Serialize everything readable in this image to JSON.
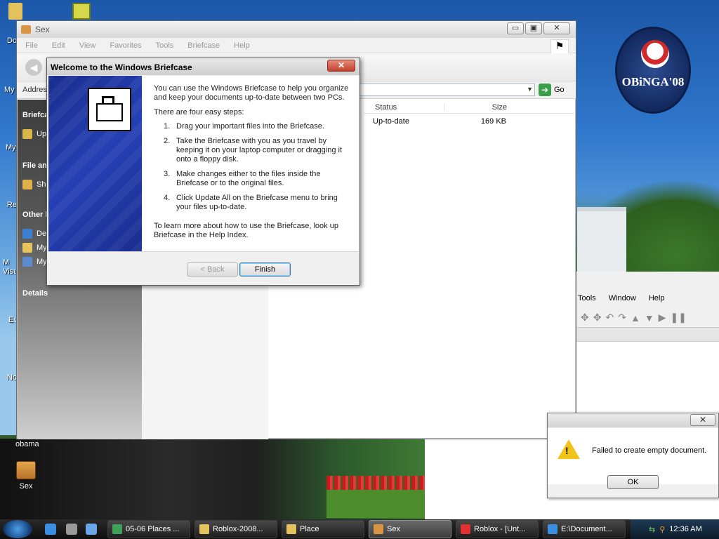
{
  "desktop": {
    "icons": [
      {
        "label": "Sex"
      }
    ],
    "partial_labels": [
      "Do",
      "My",
      "My",
      "Re",
      "M Visu",
      "Ev",
      "No",
      "obama"
    ],
    "logo_text": "OBiNGA'08"
  },
  "explorer": {
    "title": "Sex",
    "menu": [
      "File",
      "Edit",
      "View",
      "Favorites",
      "Tools",
      "Briefcase",
      "Help"
    ],
    "address_label": "Addres",
    "go_label": "Go",
    "taskpane": {
      "sections": [
        "Briefcas",
        "File an",
        "Other l",
        "Details"
      ],
      "items": [
        "Up",
        "Sh",
        "De",
        "My",
        "My"
      ]
    },
    "columns": {
      "status": "Status",
      "size": "Size"
    },
    "rows": [
      {
        "status": "Up-to-date",
        "size": "169 KB"
      }
    ]
  },
  "wizard": {
    "title": "Welcome to the Windows Briefcase",
    "intro": "You can use the Windows Briefcase to help you organize and keep your documents up-to-date between two PCs.",
    "steps_intro": "There are four easy steps:",
    "steps": [
      {
        "n": "1.",
        "text": "Drag your important files into the Briefcase."
      },
      {
        "n": "2.",
        "text": "Take the Briefcase with you as you travel by keeping it on your laptop computer or dragging it onto a floppy disk."
      },
      {
        "n": "3.",
        "text": "Make changes either to the files inside the Briefcase or to the original files."
      },
      {
        "n": "4.",
        "text": "Click Update All on the Briefcase menu to bring your files up-to-date."
      }
    ],
    "outro": "To learn more about how to use the Briefcase, look up Briefcase in the Help Index.",
    "back_label": "< Back",
    "finish_label": "Finish"
  },
  "roblox_window": {
    "menu": [
      "Tools",
      "Window",
      "Help"
    ]
  },
  "message_box": {
    "text": "Failed to create empty document.",
    "ok_label": "OK"
  },
  "taskbar": {
    "buttons": [
      {
        "label": "05-06 Places ...",
        "active": false
      },
      {
        "label": "Roblox-2008...",
        "active": false
      },
      {
        "label": "Place",
        "active": false
      },
      {
        "label": "Sex",
        "active": true
      },
      {
        "label": "Roblox - [Unt...",
        "active": false
      },
      {
        "label": "E:\\Document...",
        "active": false
      }
    ],
    "clock": "12:36 AM"
  },
  "colors": {
    "wizard_side": "#2540b5",
    "close_red": "#c0412e",
    "warning_yellow": "#f0c419",
    "go_green": "#38a048"
  }
}
